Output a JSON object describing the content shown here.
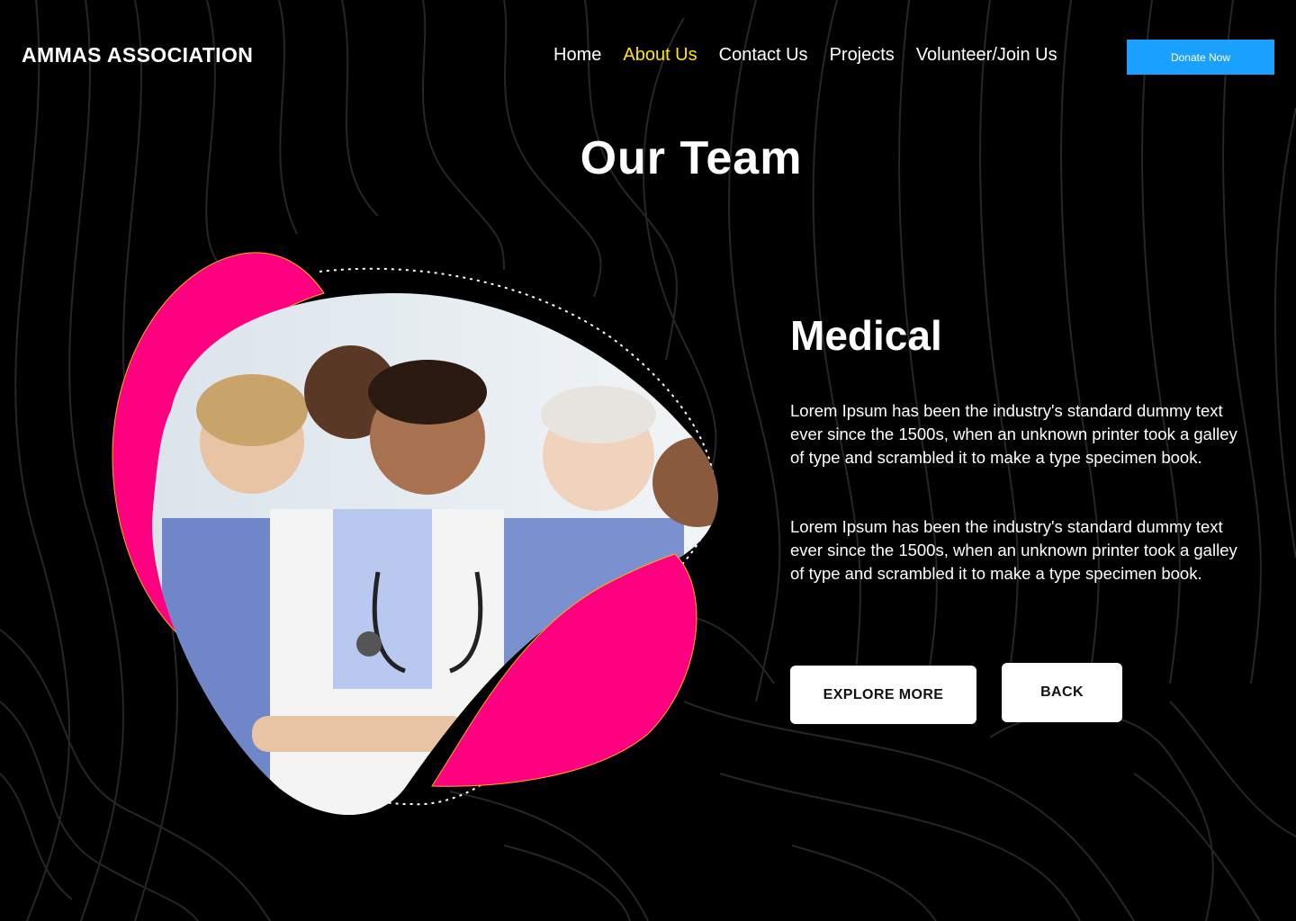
{
  "brand": {
    "name": "AMMAS ASSOCIATION"
  },
  "nav": {
    "items": [
      {
        "label": "Home",
        "active": false
      },
      {
        "label": "About Us",
        "active": true
      },
      {
        "label": "Contact Us",
        "active": false
      },
      {
        "label": "Projects",
        "active": false
      },
      {
        "label": "Volunteer/Join Us",
        "active": false
      }
    ],
    "donate_label": "Donate Now"
  },
  "page": {
    "title": "Our Team"
  },
  "section": {
    "heading": "Medical",
    "paragraphs": [
      "Lorem Ipsum has been the industry's standard dummy text ever since the 1500s, when an unknown printer took a galley of type and scrambled it to make a type specimen book.",
      "Lorem Ipsum has been the industry's standard dummy text ever since the 1500s, when an unknown printer took a galley of type and scrambled it to make a type specimen book."
    ],
    "image_subject": "medical team photo"
  },
  "buttons": {
    "explore": "EXPLORE MORE",
    "back": "BACK"
  },
  "colors": {
    "background": "#000000",
    "active_nav": "#ffe600",
    "donate": "#1aa0ff",
    "blob_pink": "#ff0080",
    "contour_line": "#2a2a2a"
  }
}
